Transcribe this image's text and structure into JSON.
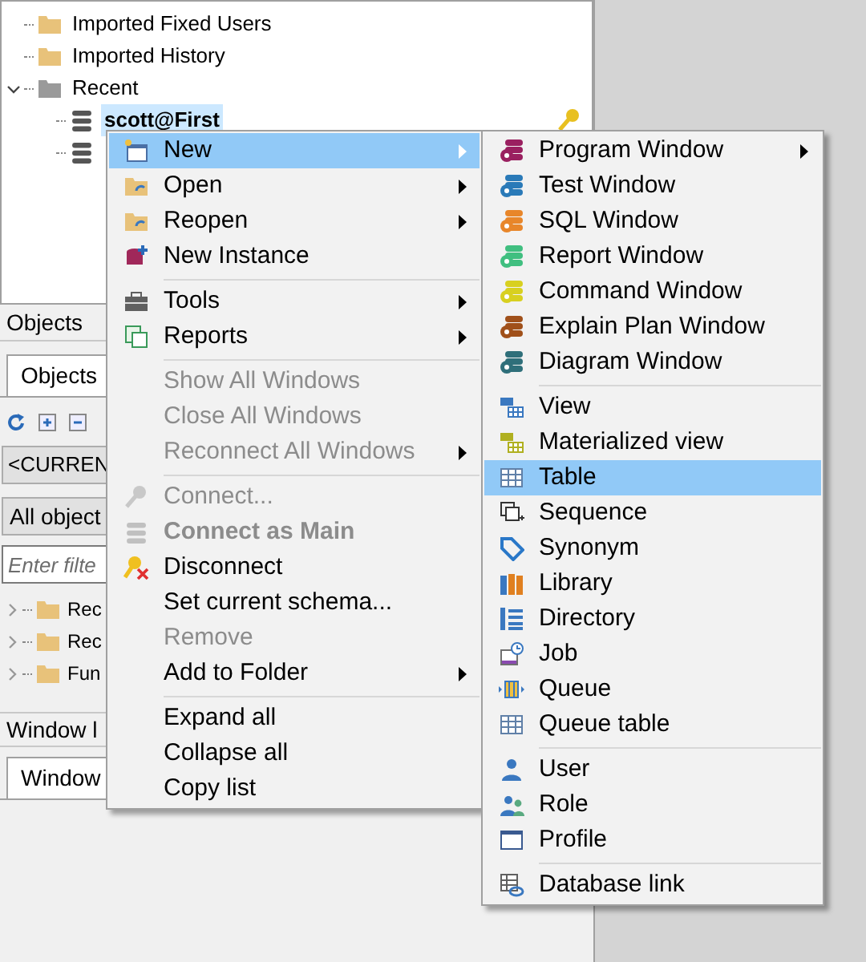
{
  "object_browser": {
    "tree": [
      {
        "label": "Imported Fixed Users",
        "kind": "folder"
      },
      {
        "label": "Imported History",
        "kind": "folder"
      },
      {
        "label": "Recent",
        "kind": "recent_folder",
        "expanded": true,
        "children": [
          {
            "label": "scott@First",
            "kind": "connection",
            "selected": true
          },
          {
            "kind": "connection"
          }
        ]
      }
    ]
  },
  "objects_panel": {
    "header": "Objects",
    "tabs": [
      {
        "label": "Objects",
        "selected": true
      }
    ],
    "user_dropdown": "<CURREN",
    "type_dropdown": "All object",
    "filter": {
      "placeholder": "Enter filte"
    },
    "tree": [
      {
        "label": "Rec",
        "expanded": false
      },
      {
        "label": "Rec",
        "expanded": false
      },
      {
        "label": "Fun",
        "expanded": false
      }
    ]
  },
  "window_list": {
    "header": "Window l",
    "tabs": [
      {
        "label": "Window",
        "selected": true
      }
    ]
  },
  "context_menu": {
    "items": [
      {
        "kind": "item",
        "label": "New",
        "selected": true,
        "disabled": false,
        "bold": false,
        "submenu": true
      },
      {
        "kind": "item",
        "label": "Open",
        "selected": false,
        "disabled": false,
        "bold": false,
        "submenu": true
      },
      {
        "kind": "item",
        "label": "Reopen",
        "selected": false,
        "disabled": false,
        "bold": false,
        "submenu": true
      },
      {
        "kind": "item",
        "label": "New Instance",
        "selected": false,
        "disabled": false,
        "bold": false,
        "submenu": false
      },
      {
        "kind": "separator"
      },
      {
        "kind": "item",
        "label": "Tools",
        "selected": false,
        "disabled": false,
        "bold": false,
        "submenu": true
      },
      {
        "kind": "item",
        "label": "Reports",
        "selected": false,
        "disabled": false,
        "bold": false,
        "submenu": true
      },
      {
        "kind": "separator"
      },
      {
        "kind": "item",
        "label": "Show All Windows",
        "selected": false,
        "disabled": true,
        "bold": false,
        "submenu": false
      },
      {
        "kind": "item",
        "label": "Close All Windows",
        "selected": false,
        "disabled": true,
        "bold": false,
        "submenu": false
      },
      {
        "kind": "item",
        "label": "Reconnect All Windows",
        "selected": false,
        "disabled": true,
        "bold": false,
        "submenu": true
      },
      {
        "kind": "separator"
      },
      {
        "kind": "item",
        "label": "Connect...",
        "selected": false,
        "disabled": true,
        "bold": false,
        "submenu": false
      },
      {
        "kind": "item",
        "label": "Connect as Main",
        "selected": false,
        "disabled": true,
        "bold": true,
        "submenu": false
      },
      {
        "kind": "item",
        "label": "Disconnect",
        "selected": false,
        "disabled": false,
        "bold": false,
        "submenu": false
      },
      {
        "kind": "item",
        "label": "Set current schema...",
        "selected": false,
        "disabled": false,
        "bold": false,
        "submenu": false
      },
      {
        "kind": "item",
        "label": "Remove",
        "selected": false,
        "disabled": true,
        "bold": false,
        "submenu": false
      },
      {
        "kind": "item",
        "label": "Add to Folder",
        "selected": false,
        "disabled": false,
        "bold": false,
        "submenu": true
      },
      {
        "kind": "separator"
      },
      {
        "kind": "item",
        "label": "Expand all",
        "selected": false,
        "disabled": false,
        "bold": false,
        "submenu": false
      },
      {
        "kind": "item",
        "label": "Collapse all",
        "selected": false,
        "disabled": false,
        "bold": false,
        "submenu": false
      },
      {
        "kind": "item",
        "label": "Copy list",
        "selected": false,
        "disabled": false,
        "bold": false,
        "submenu": false
      }
    ]
  },
  "new_submenu": {
    "items": [
      {
        "kind": "item",
        "label": "Program Window",
        "selected": false,
        "submenu": true
      },
      {
        "kind": "item",
        "label": "Test Window",
        "selected": false,
        "submenu": false
      },
      {
        "kind": "item",
        "label": "SQL Window",
        "selected": false,
        "submenu": false
      },
      {
        "kind": "item",
        "label": "Report Window",
        "selected": false,
        "submenu": false
      },
      {
        "kind": "item",
        "label": "Command Window",
        "selected": false,
        "submenu": false
      },
      {
        "kind": "item",
        "label": "Explain Plan Window",
        "selected": false,
        "submenu": false
      },
      {
        "kind": "item",
        "label": "Diagram Window",
        "selected": false,
        "submenu": false
      },
      {
        "kind": "separator"
      },
      {
        "kind": "item",
        "label": "View",
        "selected": false,
        "submenu": false
      },
      {
        "kind": "item",
        "label": "Materialized view",
        "selected": false,
        "submenu": false
      },
      {
        "kind": "item",
        "label": "Table",
        "selected": true,
        "submenu": false
      },
      {
        "kind": "item",
        "label": "Sequence",
        "selected": false,
        "submenu": false
      },
      {
        "kind": "item",
        "label": "Synonym",
        "selected": false,
        "submenu": false
      },
      {
        "kind": "item",
        "label": "Library",
        "selected": false,
        "submenu": false
      },
      {
        "kind": "item",
        "label": "Directory",
        "selected": false,
        "submenu": false
      },
      {
        "kind": "item",
        "label": "Job",
        "selected": false,
        "submenu": false
      },
      {
        "kind": "item",
        "label": "Queue",
        "selected": false,
        "submenu": false
      },
      {
        "kind": "item",
        "label": "Queue table",
        "selected": false,
        "submenu": false
      },
      {
        "kind": "separator"
      },
      {
        "kind": "item",
        "label": "User",
        "selected": false,
        "submenu": false
      },
      {
        "kind": "item",
        "label": "Role",
        "selected": false,
        "submenu": false
      },
      {
        "kind": "item",
        "label": "Profile",
        "selected": false,
        "submenu": false
      },
      {
        "kind": "separator"
      },
      {
        "kind": "item",
        "label": "Database link",
        "selected": false,
        "submenu": false
      }
    ]
  }
}
